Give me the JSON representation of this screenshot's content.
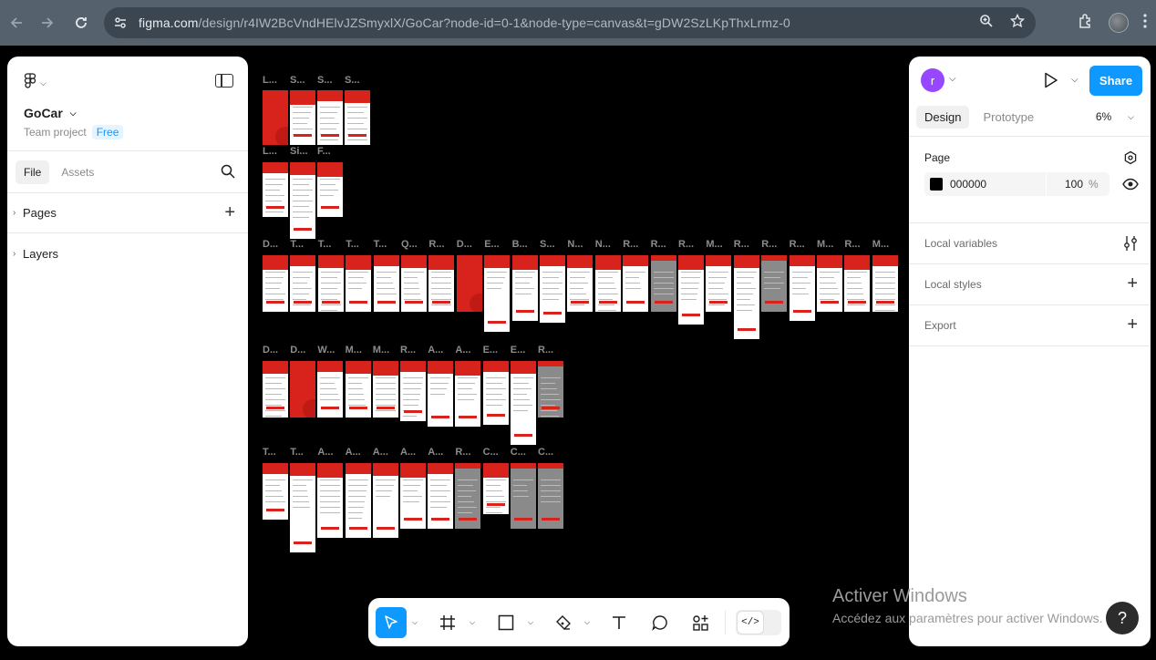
{
  "browser": {
    "url_host": "figma.com",
    "url_path": "/design/r4IW2BcVndHElvJZSmyxlX/GoCar?node-id=0-1&node-type=canvas&t=gDW2SzLKpThxLrmz-0"
  },
  "left_panel": {
    "project_name": "GoCar",
    "project_type": "Team project",
    "plan_badge": "Free",
    "tabs": [
      "File",
      "Assets"
    ],
    "sections": [
      "Pages",
      "Layers"
    ]
  },
  "right_panel": {
    "user_initial": "r",
    "share_label": "Share",
    "tabs": [
      "Design",
      "Prototype"
    ],
    "zoom": "6%",
    "page_label": "Page",
    "bg_color": "000000",
    "bg_opacity": "100",
    "bg_opacity_unit": "%",
    "rows": [
      "Local variables",
      "Local styles",
      "Export"
    ]
  },
  "canvas": {
    "row1_labels": [
      "L...",
      "S...",
      "S...",
      "S..."
    ],
    "row1b_labels": [
      "L...",
      "Si...",
      "F..."
    ],
    "row2_labels": [
      "D...",
      "T...",
      "T...",
      "T...",
      "T...",
      "Q...",
      "R...",
      "D...",
      "E...",
      "B...",
      "S...",
      "N...",
      "N...",
      "R...",
      "R...",
      "R...",
      "M...",
      "R...",
      "R...",
      "R...",
      "M...",
      "R...",
      "M..."
    ],
    "row3_labels": [
      "D...",
      "D...",
      "W...",
      "M...",
      "M...",
      "R...",
      "A...",
      "A...",
      "E...",
      "E...",
      "R..."
    ],
    "row4_labels": [
      "T...",
      "T...",
      "A...",
      "A...",
      "A...",
      "A...",
      "A...",
      "R...",
      "C...",
      "C...",
      "C..."
    ]
  },
  "toolbar": {
    "dev_mode_glyph": "</>"
  },
  "watermark": {
    "title": "Activer Windows",
    "subtitle": "Accédez aux paramètres pour activer Windows."
  },
  "help": "?"
}
